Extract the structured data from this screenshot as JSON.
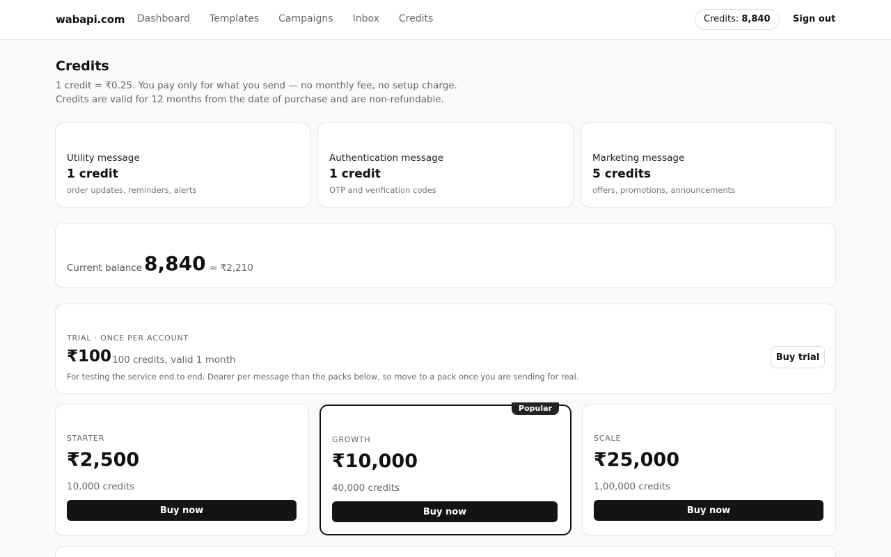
{
  "app": {
    "logo": "wabapi.com"
  },
  "nav": {
    "items": [
      {
        "label": "Dashboard"
      },
      {
        "label": "Templates"
      },
      {
        "label": "Campaigns"
      },
      {
        "label": "Inbox"
      },
      {
        "label": "Credits"
      }
    ],
    "credits_label": "Credits:",
    "credits_value": "8,840",
    "signout": "Sign out"
  },
  "page": {
    "title": "Credits",
    "sub1": "1 credit = ₹0.25. You pay only for what you send — no monthly fee, no setup charge.",
    "sub2": "Credits are valid for 12 months from the date of purchase and are non-refundable."
  },
  "message_types": [
    {
      "name": "Utility message",
      "cost": "1 credit",
      "desc": "order updates, reminders, alerts"
    },
    {
      "name": "Authentication message",
      "cost": "1 credit",
      "desc": "OTP and verification codes"
    },
    {
      "name": "Marketing message",
      "cost": "5 credits",
      "desc": "offers, promotions, announcements"
    }
  ],
  "balance": {
    "label": "Current balance",
    "value": "8,840",
    "approx": "≈ ₹2,210"
  },
  "trial": {
    "tag": "TRIAL · ONCE PER ACCOUNT",
    "price": "₹100",
    "credits": "100 credits, valid 1 month",
    "note": "For testing the service end to end. Dearer per message than the packs below, so move to a pack once you are sending for real.",
    "button": "Buy trial"
  },
  "packs": [
    {
      "name": "STARTER",
      "price": "₹2,500",
      "credits": "10,000 credits",
      "button": "Buy now"
    },
    {
      "name": "GROWTH",
      "price": "₹10,000",
      "credits": "40,000 credits",
      "button": "Buy now",
      "badge": "Popular"
    },
    {
      "name": "SCALE",
      "price": "₹25,000",
      "credits": "1,00,000 credits",
      "button": "Buy now"
    }
  ]
}
